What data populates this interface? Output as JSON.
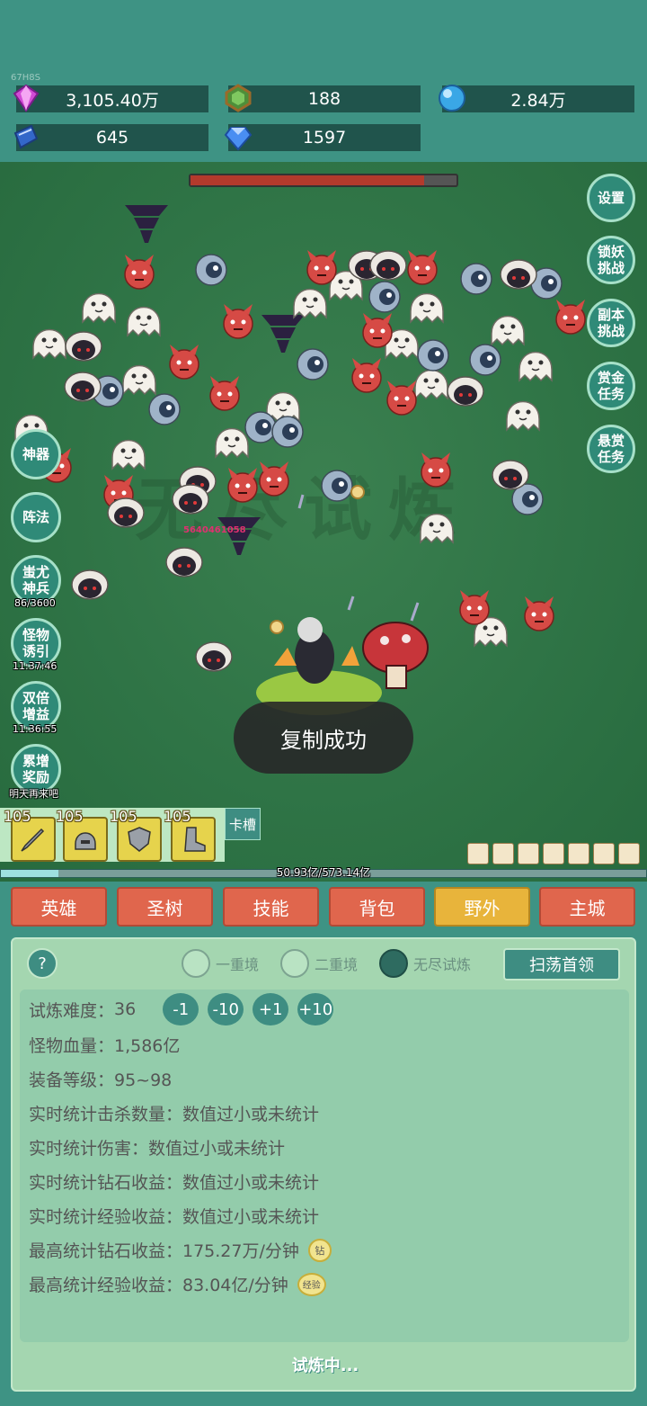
{
  "version": "67H8S",
  "resources": {
    "diamond": "3,105.40万",
    "gem_green": "188",
    "orb": "2.84万",
    "book": "645",
    "crystal": "1597"
  },
  "boss_hp_fraction": 0.88,
  "right_buttons": {
    "settings": "设置",
    "demon": "锁妖\n挑战",
    "dungeon": "副本\n挑战",
    "bounty": "赏金\n任务",
    "reward": "悬赏\n任务"
  },
  "left_buttons": {
    "artifact": "神器",
    "formation": "阵法",
    "weapon": "蚩尤\n神兵",
    "weapon_sub": "86/3600",
    "lure": "怪物\n诱引",
    "lure_sub": "11:37:46",
    "double": "双倍\n增益",
    "double_sub": "11:36:55",
    "accum": "累增\n奖励",
    "accum_sub": "明天再来吧"
  },
  "damage_number": "5640461058",
  "watermark": "无尽试炼",
  "toast": "复制成功",
  "equipment": {
    "levels": [
      "105",
      "105",
      "105",
      "105"
    ],
    "card_slot": "卡槽"
  },
  "xp": {
    "text": "50.93亿/573.14亿",
    "fraction": 0.089
  },
  "tabs": [
    "英雄",
    "圣树",
    "技能",
    "背包",
    "野外",
    "主城"
  ],
  "active_tab": "野外",
  "panel": {
    "help": "?",
    "modes": [
      "一重境",
      "二重境",
      "无尽试炼"
    ],
    "selected_mode": "无尽试炼",
    "sweep": "扫荡首领",
    "difficulty_label": "试炼难度：",
    "difficulty_value": "36",
    "diff_buttons": [
      "-1",
      "-10",
      "+1",
      "+10"
    ],
    "hp": "怪物血量：1,586亿",
    "equip_level": "装备等级：95~98",
    "kills": "实时统计击杀数量：数值过小或未统计",
    "damage": "实时统计伤害：数值过小或未统计",
    "diamond_income": "实时统计钻石收益：数值过小或未统计",
    "exp_income": "实时统计经验收益：数值过小或未统计",
    "max_diamond": "最高统计钻石收益：175.27万/分钟",
    "max_diamond_icon": "钻",
    "max_exp": "最高统计经验收益：83.04亿/分钟",
    "max_exp_icon": "经验",
    "status": "试炼中..."
  },
  "colors": {
    "background": "#3e9384",
    "battlefield": "#2f7446",
    "tab": "#e0664d",
    "tab_active": "#e8b43b",
    "panel": "#a4d6b0"
  }
}
